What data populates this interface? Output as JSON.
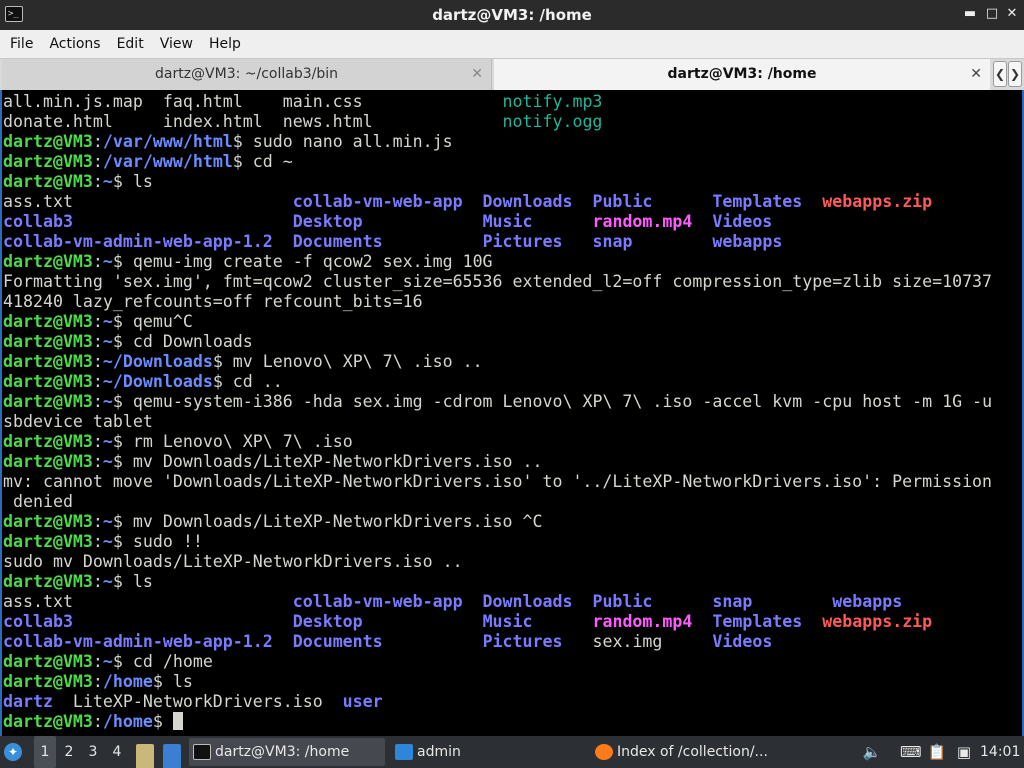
{
  "window": {
    "title": "dartz@VM3: /home",
    "app_icon": "terminal-icon",
    "controls": [
      "minimize-icon",
      "maximize-icon",
      "close-icon"
    ]
  },
  "menu": [
    "File",
    "Actions",
    "Edit",
    "View",
    "Help"
  ],
  "tabs": [
    {
      "label": "dartz@VM3: ~/collab3/bin",
      "active": false
    },
    {
      "label": "dartz@VM3: /home",
      "active": true
    }
  ],
  "tab_scroll": {
    "left": "❮",
    "right": "❯"
  },
  "terminal": {
    "lines": [
      [
        [
          "all.min.js.map  faq.html    main.css              ",
          "plain"
        ],
        [
          "notify.mp3",
          "media"
        ]
      ],
      [
        [
          "donate.html     index.html  news.html             ",
          "plain"
        ],
        [
          "notify.ogg",
          "media"
        ]
      ],
      [
        [
          "dartz@VM3",
          "user"
        ],
        [
          ":",
          "plain"
        ],
        [
          "/var/www/html",
          "path"
        ],
        [
          "$ sudo nano all.min.js",
          "plain"
        ]
      ],
      [
        [
          "dartz@VM3",
          "user"
        ],
        [
          ":",
          "plain"
        ],
        [
          "/var/www/html",
          "path"
        ],
        [
          "$ cd ~",
          "plain"
        ]
      ],
      [
        [
          "dartz@VM3",
          "user"
        ],
        [
          ":",
          "plain"
        ],
        [
          "~",
          "path"
        ],
        [
          "$ ls",
          "plain"
        ]
      ],
      [
        [
          "ass.txt                      ",
          "plain"
        ],
        [
          "collab-vm-web-app",
          "dir"
        ],
        [
          "  ",
          "plain"
        ],
        [
          "Downloads",
          "dir"
        ],
        [
          "  ",
          "plain"
        ],
        [
          "Public",
          "dir"
        ],
        [
          "      ",
          "plain"
        ],
        [
          "Templates",
          "dir"
        ],
        [
          "  ",
          "plain"
        ],
        [
          "webapps.zip",
          "zip"
        ]
      ],
      [
        [
          "collab3",
          "dir"
        ],
        [
          "                      ",
          "plain"
        ],
        [
          "Desktop",
          "dir"
        ],
        [
          "            ",
          "plain"
        ],
        [
          "Music",
          "dir"
        ],
        [
          "      ",
          "plain"
        ],
        [
          "random.mp4",
          "video"
        ],
        [
          "  ",
          "plain"
        ],
        [
          "Videos",
          "dir"
        ]
      ],
      [
        [
          "collab-vm-admin-web-app-1.2",
          "dir"
        ],
        [
          "  ",
          "plain"
        ],
        [
          "Documents",
          "dir"
        ],
        [
          "          ",
          "plain"
        ],
        [
          "Pictures",
          "dir"
        ],
        [
          "   ",
          "plain"
        ],
        [
          "snap",
          "dir"
        ],
        [
          "        ",
          "plain"
        ],
        [
          "webapps",
          "dir"
        ]
      ],
      [
        [
          "dartz@VM3",
          "user"
        ],
        [
          ":",
          "plain"
        ],
        [
          "~",
          "path"
        ],
        [
          "$ qemu-img create -f qcow2 sex.img 10G",
          "plain"
        ]
      ],
      [
        [
          "Formatting 'sex.img', fmt=qcow2 cluster_size=65536 extended_l2=off compression_type=zlib size=10737",
          "plain"
        ]
      ],
      [
        [
          "418240 lazy_refcounts=off refcount_bits=16",
          "plain"
        ]
      ],
      [
        [
          "dartz@VM3",
          "user"
        ],
        [
          ":",
          "plain"
        ],
        [
          "~",
          "path"
        ],
        [
          "$ qemu^C",
          "plain"
        ]
      ],
      [
        [
          "dartz@VM3",
          "user"
        ],
        [
          ":",
          "plain"
        ],
        [
          "~",
          "path"
        ],
        [
          "$ cd Downloads",
          "plain"
        ]
      ],
      [
        [
          "dartz@VM3",
          "user"
        ],
        [
          ":",
          "plain"
        ],
        [
          "~/Downloads",
          "path"
        ],
        [
          "$ mv Lenovo\\ XP\\ 7\\ .iso ..",
          "plain"
        ]
      ],
      [
        [
          "dartz@VM3",
          "user"
        ],
        [
          ":",
          "plain"
        ],
        [
          "~/Downloads",
          "path"
        ],
        [
          "$ cd ..",
          "plain"
        ]
      ],
      [
        [
          "dartz@VM3",
          "user"
        ],
        [
          ":",
          "plain"
        ],
        [
          "~",
          "path"
        ],
        [
          "$ qemu-system-i386 -hda sex.img -cdrom Lenovo\\ XP\\ 7\\ .iso -accel kvm -cpu host -m 1G -u",
          "plain"
        ]
      ],
      [
        [
          "sbdevice tablet",
          "plain"
        ]
      ],
      [
        [
          "dartz@VM3",
          "user"
        ],
        [
          ":",
          "plain"
        ],
        [
          "~",
          "path"
        ],
        [
          "$ rm Lenovo\\ XP\\ 7\\ .iso",
          "plain"
        ]
      ],
      [
        [
          "dartz@VM3",
          "user"
        ],
        [
          ":",
          "plain"
        ],
        [
          "~",
          "path"
        ],
        [
          "$ mv Downloads/LiteXP-NetworkDrivers.iso ..",
          "plain"
        ]
      ],
      [
        [
          "mv: cannot move 'Downloads/LiteXP-NetworkDrivers.iso' to '../LiteXP-NetworkDrivers.iso': Permission",
          "plain"
        ]
      ],
      [
        [
          " denied",
          "plain"
        ]
      ],
      [
        [
          "dartz@VM3",
          "user"
        ],
        [
          ":",
          "plain"
        ],
        [
          "~",
          "path"
        ],
        [
          "$ mv Downloads/LiteXP-NetworkDrivers.iso ^C",
          "plain"
        ]
      ],
      [
        [
          "dartz@VM3",
          "user"
        ],
        [
          ":",
          "plain"
        ],
        [
          "~",
          "path"
        ],
        [
          "$ sudo !!",
          "plain"
        ]
      ],
      [
        [
          "sudo mv Downloads/LiteXP-NetworkDrivers.iso ..",
          "plain"
        ]
      ],
      [
        [
          "dartz@VM3",
          "user"
        ],
        [
          ":",
          "plain"
        ],
        [
          "~",
          "path"
        ],
        [
          "$ ls",
          "plain"
        ]
      ],
      [
        [
          "ass.txt                      ",
          "plain"
        ],
        [
          "collab-vm-web-app",
          "dir"
        ],
        [
          "  ",
          "plain"
        ],
        [
          "Downloads",
          "dir"
        ],
        [
          "  ",
          "plain"
        ],
        [
          "Public",
          "dir"
        ],
        [
          "      ",
          "plain"
        ],
        [
          "snap",
          "dir"
        ],
        [
          "        ",
          "plain"
        ],
        [
          "webapps",
          "dir"
        ]
      ],
      [
        [
          "collab3",
          "dir"
        ],
        [
          "                      ",
          "plain"
        ],
        [
          "Desktop",
          "dir"
        ],
        [
          "            ",
          "plain"
        ],
        [
          "Music",
          "dir"
        ],
        [
          "      ",
          "plain"
        ],
        [
          "random.mp4",
          "video"
        ],
        [
          "  ",
          "plain"
        ],
        [
          "Templates",
          "dir"
        ],
        [
          "  ",
          "plain"
        ],
        [
          "webapps.zip",
          "zip"
        ]
      ],
      [
        [
          "collab-vm-admin-web-app-1.2",
          "dir"
        ],
        [
          "  ",
          "plain"
        ],
        [
          "Documents",
          "dir"
        ],
        [
          "          ",
          "plain"
        ],
        [
          "Pictures",
          "dir"
        ],
        [
          "   ",
          "plain"
        ],
        [
          "sex.img",
          "plain"
        ],
        [
          "     ",
          "plain"
        ],
        [
          "Videos",
          "dir"
        ]
      ],
      [
        [
          "dartz@VM3",
          "user"
        ],
        [
          ":",
          "plain"
        ],
        [
          "~",
          "path"
        ],
        [
          "$ cd /home",
          "plain"
        ]
      ],
      [
        [
          "dartz@VM3",
          "user"
        ],
        [
          ":",
          "plain"
        ],
        [
          "/home",
          "path"
        ],
        [
          "$ ls",
          "plain"
        ]
      ],
      [
        [
          "dartz",
          "dir"
        ],
        [
          "  LiteXP-NetworkDrivers.iso  ",
          "plain"
        ],
        [
          "user",
          "dir"
        ]
      ],
      [
        [
          "dartz@VM3",
          "user"
        ],
        [
          ":",
          "plain"
        ],
        [
          "/home",
          "path"
        ],
        [
          "$ ",
          "plain"
        ]
      ]
    ]
  },
  "taskbar": {
    "start_icon": "start-menu-icon",
    "workspaces": [
      "1",
      "2",
      "3",
      "4"
    ],
    "active_workspace": "1",
    "launchers": [
      "file-manager-icon",
      "show-desktop-icon"
    ],
    "tasks": [
      {
        "label": "dartz@VM3: /home",
        "icon": "terminal-icon"
      },
      {
        "label": "admin",
        "icon": "folder-icon"
      },
      {
        "label": "Index of /collection/...",
        "icon": "firefox-icon"
      }
    ],
    "tray_icons": [
      "volume-icon",
      "keyboard-icon",
      "clipboard-icon",
      "screen-icon"
    ],
    "clock": "14:01"
  },
  "colors": {
    "user": "#4ed94a",
    "path": "#6b8cff",
    "dir": "#7b7bff",
    "media": "#1fb59a",
    "zip": "#ff5a5a",
    "video": "#ff5cff",
    "text": "#d3d7cf",
    "accent": "#2b6bbd"
  }
}
